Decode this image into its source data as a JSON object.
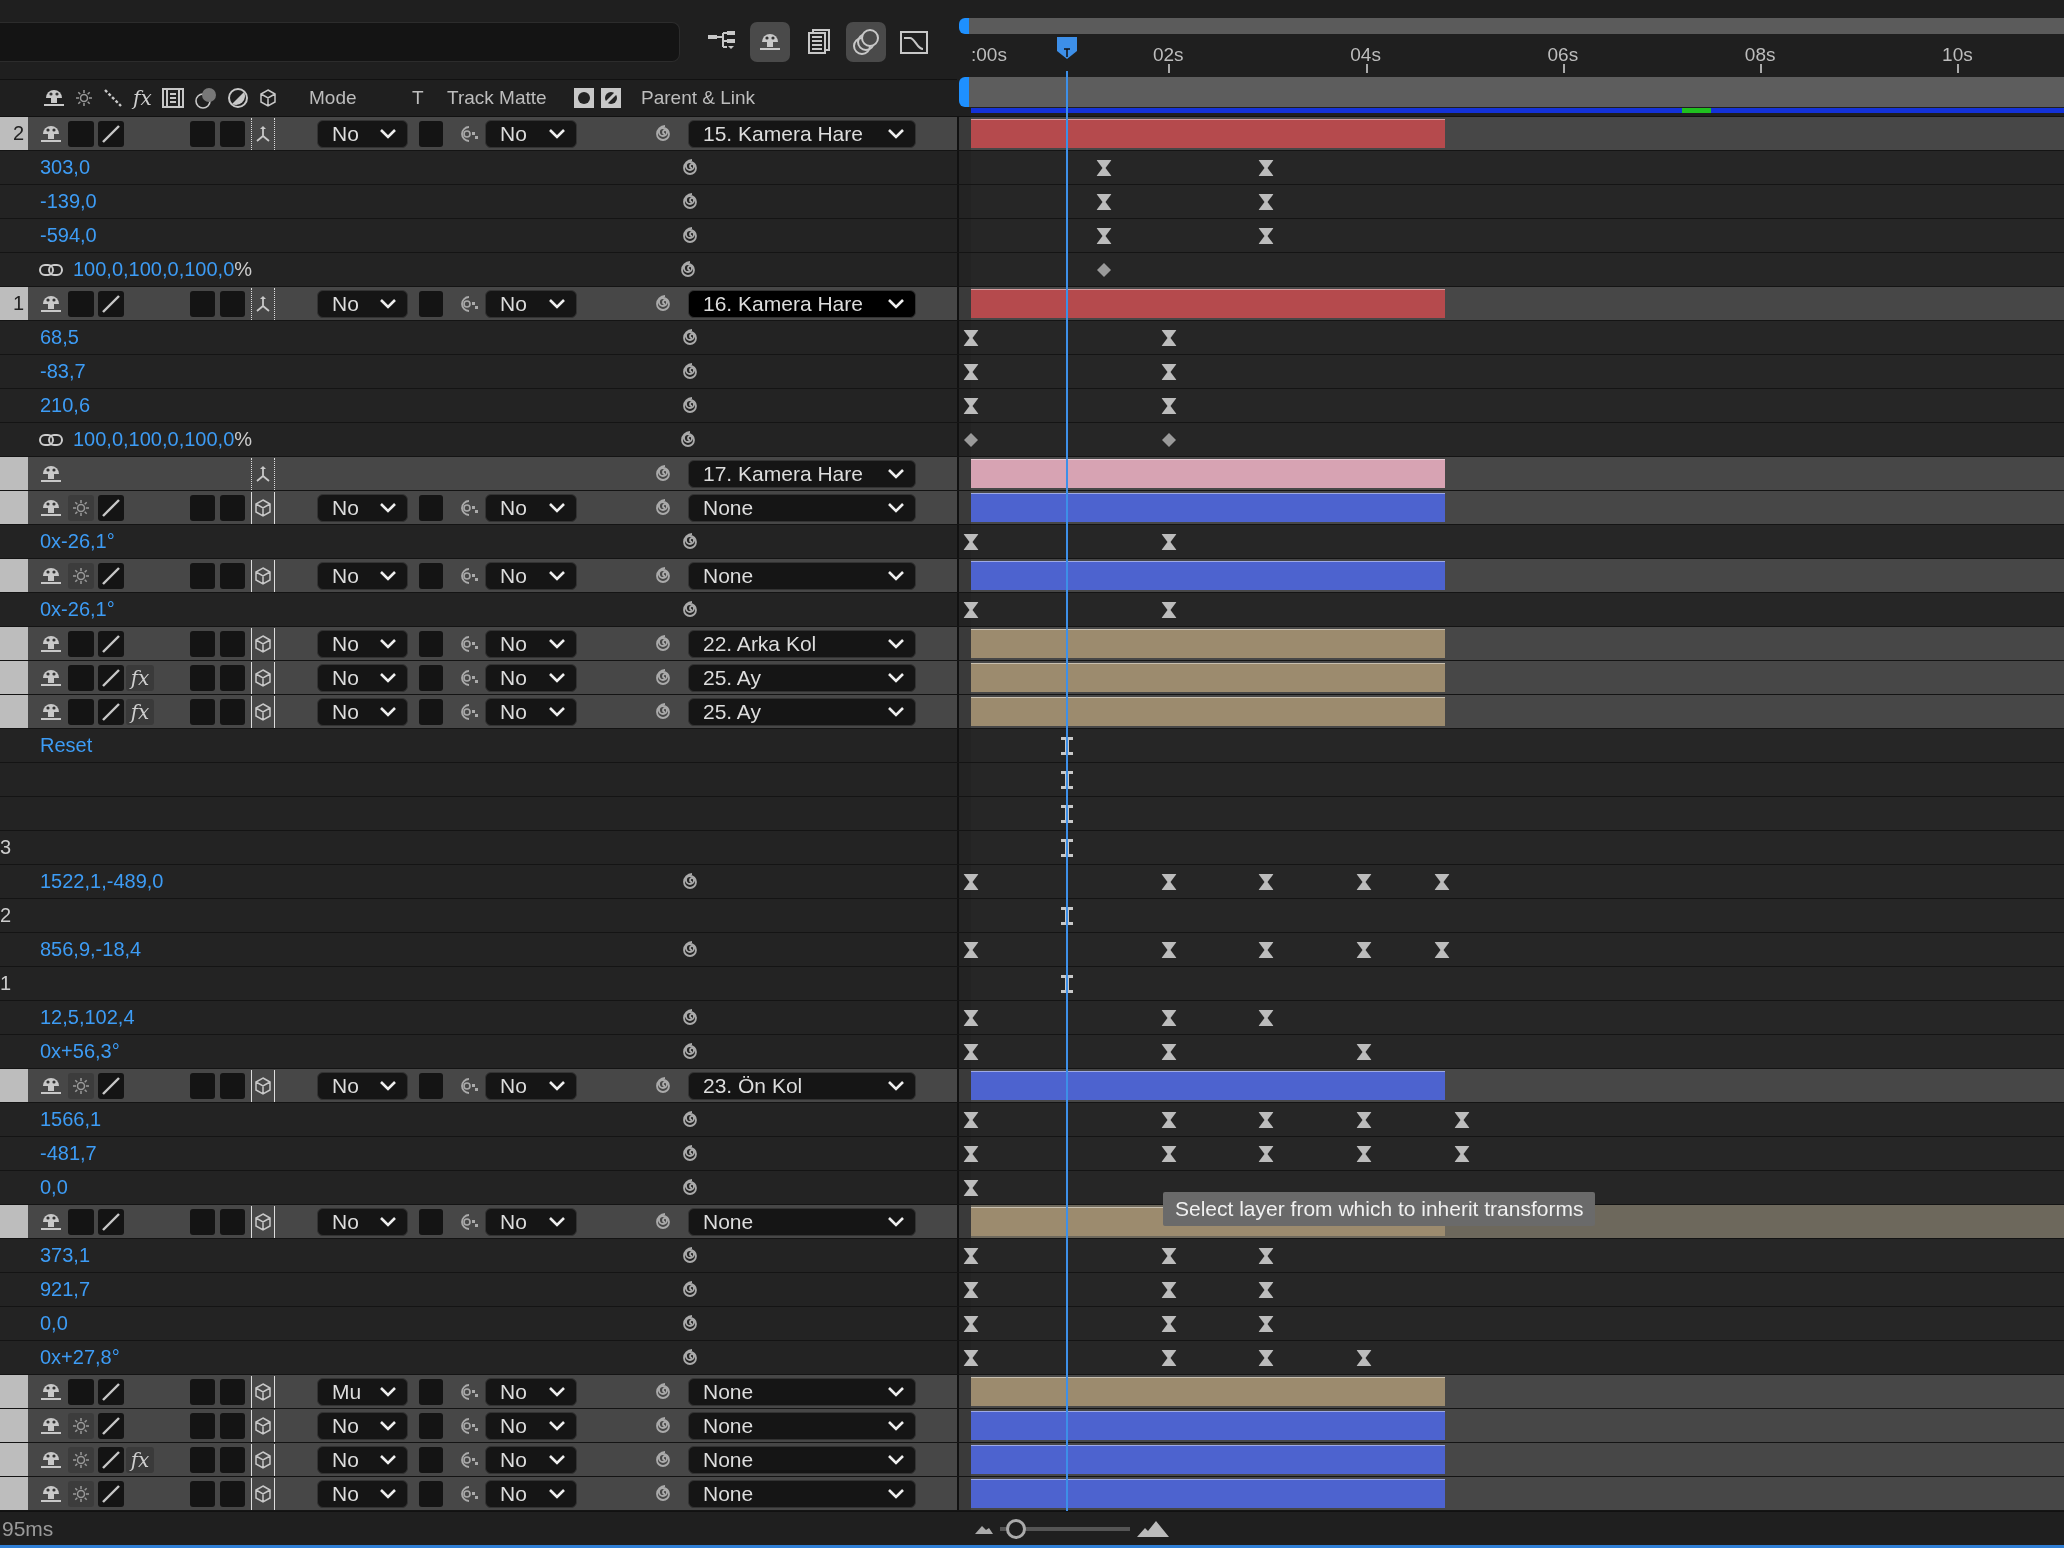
{
  "toolbar": {
    "buttons": [
      {
        "kind": "hierarchy",
        "selected": false
      },
      {
        "kind": "shy",
        "selected": true
      },
      {
        "kind": "frames",
        "selected": false
      },
      {
        "kind": "motion-blur",
        "selected": true
      },
      {
        "kind": "graph",
        "selected": false
      }
    ]
  },
  "header": {
    "fx": "fx",
    "mode": "Mode",
    "t": "T",
    "track_matte": "Track Matte",
    "parent": "Parent & Link"
  },
  "ruler": [
    ":00s",
    "02s",
    "04s",
    "06s",
    "08s",
    "10s"
  ],
  "playhead": {
    "level": 0.088
  },
  "rows": [
    {
      "kind": "layer",
      "label": "2",
      "camera": true,
      "collapse": false,
      "quality": true,
      "mode": "No",
      "track": "No",
      "parent": "15. Kamera Hare",
      "parent_focused": false,
      "selected": false,
      "bar": {
        "color": "#b54a4d",
        "level": 0.434
      }
    },
    {
      "kind": "property",
      "value": "303,0",
      "spiral": true,
      "keys": [
        {
          "kind": "ease",
          "level": 0.122
        },
        {
          "kind": "ease",
          "level": 0.27
        }
      ]
    },
    {
      "kind": "property",
      "value": "-139,0",
      "spiral": true,
      "keys": [
        {
          "kind": "ease",
          "level": 0.122
        },
        {
          "kind": "ease",
          "level": 0.27
        }
      ]
    },
    {
      "kind": "property",
      "value": "-594,0",
      "spiral": true,
      "keys": [
        {
          "kind": "ease",
          "level": 0.122
        },
        {
          "kind": "ease",
          "level": 0.27
        }
      ]
    },
    {
      "kind": "property",
      "linked": true,
      "value": "100,0,100,0,100,0",
      "unit": "%",
      "spiral": true,
      "keys": [
        {
          "kind": "diamond",
          "level": 0.122
        }
      ]
    },
    {
      "kind": "layer",
      "label": "1",
      "camera": true,
      "collapse": false,
      "quality": true,
      "mode": "No",
      "track": "No",
      "parent": "16. Kamera Hare",
      "parent_focused": true,
      "selected": false,
      "bar": {
        "color": "#b54a4d",
        "level": 0.434
      }
    },
    {
      "kind": "property",
      "value": "68,5",
      "spiral": true,
      "keys": [
        {
          "kind": "ease",
          "level": 0
        },
        {
          "kind": "ease",
          "level": 0.181
        }
      ]
    },
    {
      "kind": "property",
      "value": "-83,7",
      "spiral": true,
      "keys": [
        {
          "kind": "ease",
          "level": 0
        },
        {
          "kind": "ease",
          "level": 0.181
        }
      ]
    },
    {
      "kind": "property",
      "value": "210,6",
      "spiral": true,
      "keys": [
        {
          "kind": "ease",
          "level": 0
        },
        {
          "kind": "ease",
          "level": 0.181
        }
      ]
    },
    {
      "kind": "property",
      "linked": true,
      "value": "100,0,100,0,100,0",
      "unit": "%",
      "spiral": true,
      "keys": [
        {
          "kind": "diamond",
          "level": 0
        },
        {
          "kind": "diamond",
          "level": 0.181
        }
      ]
    },
    {
      "kind": "layer",
      "camera": true,
      "parent": "17. Kamera Hare",
      "parent_focused": false,
      "selected": false,
      "bar": {
        "color": "#d7a3b3",
        "level": 0.434
      }
    },
    {
      "kind": "layer",
      "camera": false,
      "collapse": true,
      "quality": true,
      "mode": "No",
      "track": "No",
      "parent": "None",
      "parent_focused": false,
      "selected": false,
      "bar": {
        "color": "#4d63cf",
        "level": 0.434
      }
    },
    {
      "kind": "property",
      "value": "0x-26,1°",
      "spiral": true,
      "keys": [
        {
          "kind": "ease",
          "level": 0
        },
        {
          "kind": "ease",
          "level": 0.181
        }
      ]
    },
    {
      "kind": "layer",
      "camera": false,
      "collapse": true,
      "quality": true,
      "mode": "No",
      "track": "No",
      "parent": "None",
      "parent_focused": false,
      "selected": false,
      "bar": {
        "color": "#4d63cf",
        "level": 0.434
      }
    },
    {
      "kind": "property",
      "value": "0x-26,1°",
      "spiral": true,
      "keys": [
        {
          "kind": "ease",
          "level": 0
        },
        {
          "kind": "ease",
          "level": 0.181
        }
      ]
    },
    {
      "kind": "layer",
      "camera": false,
      "collapse": false,
      "quality": true,
      "mode": "No",
      "track": "No",
      "parent": "22. Arka Kol",
      "parent_focused": false,
      "selected": false,
      "bar": {
        "color": "#9c8b6e",
        "level": 0.434
      }
    },
    {
      "kind": "layer",
      "camera": false,
      "collapse": false,
      "quality": true,
      "fx": "fx",
      "effects_on": true,
      "mode": "No",
      "track": "No",
      "parent": "25. Ay",
      "parent_focused": false,
      "selected": false,
      "bar": {
        "color": "#9c8b6e",
        "level": 0.434
      }
    },
    {
      "kind": "layer",
      "camera": false,
      "collapse": false,
      "quality": true,
      "fx": "fx",
      "effects_on": true,
      "mode": "No",
      "track": "No",
      "parent": "25. Ay",
      "parent_focused": false,
      "selected": false,
      "bar": {
        "color": "#9c8b6e",
        "level": 0.434
      }
    },
    {
      "kind": "property",
      "value": "Reset",
      "keys": [
        {
          "kind": "hold",
          "level": 0.088
        }
      ]
    },
    {
      "kind": "property",
      "keys": [
        {
          "kind": "hold",
          "level": 0.088
        }
      ]
    },
    {
      "kind": "property",
      "keys": [
        {
          "kind": "hold",
          "level": 0.088
        }
      ]
    },
    {
      "kind": "property",
      "index": "3",
      "keys": [
        {
          "kind": "hold",
          "level": 0.088
        }
      ]
    },
    {
      "kind": "property",
      "value": "1522,1,-489,0",
      "spiral": true,
      "keys": [
        {
          "kind": "ease",
          "level": 0
        },
        {
          "kind": "ease",
          "level": 0.181
        },
        {
          "kind": "ease",
          "level": 0.27
        },
        {
          "kind": "ease",
          "level": 0.36
        },
        {
          "kind": "ease",
          "level": 0.431
        }
      ]
    },
    {
      "kind": "property",
      "index": "2",
      "keys": [
        {
          "kind": "hold",
          "level": 0.088
        }
      ]
    },
    {
      "kind": "property",
      "value": "856,9,-18,4",
      "spiral": true,
      "keys": [
        {
          "kind": "ease",
          "level": 0
        },
        {
          "kind": "ease",
          "level": 0.181
        },
        {
          "kind": "ease",
          "level": 0.27
        },
        {
          "kind": "ease",
          "level": 0.36
        },
        {
          "kind": "ease",
          "level": 0.431
        }
      ]
    },
    {
      "kind": "property",
      "index": "1",
      "keys": [
        {
          "kind": "hold",
          "level": 0.088
        }
      ]
    },
    {
      "kind": "property",
      "value": "12,5,102,4",
      "spiral": true,
      "keys": [
        {
          "kind": "ease",
          "level": 0
        },
        {
          "kind": "ease",
          "level": 0.181
        },
        {
          "kind": "ease",
          "level": 0.27
        }
      ]
    },
    {
      "kind": "property",
      "value": "0x+56,3°",
      "spiral": true,
      "keys": [
        {
          "kind": "ease",
          "level": 0
        },
        {
          "kind": "ease",
          "level": 0.181
        },
        {
          "kind": "ease",
          "level": 0.36
        }
      ]
    },
    {
      "kind": "layer",
      "camera": false,
      "collapse": true,
      "quality": true,
      "mode": "No",
      "track": "No",
      "parent": "23. Ön Kol",
      "parent_focused": false,
      "selected": false,
      "bar": {
        "color": "#4d63cf",
        "level": 0.434
      }
    },
    {
      "kind": "property",
      "value": "1566,1",
      "spiral": true,
      "keys": [
        {
          "kind": "ease",
          "level": 0
        },
        {
          "kind": "ease",
          "level": 0.181
        },
        {
          "kind": "ease",
          "level": 0.27
        },
        {
          "kind": "ease",
          "level": 0.36
        },
        {
          "kind": "ease",
          "level": 0.449
        }
      ]
    },
    {
      "kind": "property",
      "value": "-481,7",
      "spiral": true,
      "keys": [
        {
          "kind": "ease",
          "level": 0
        },
        {
          "kind": "ease",
          "level": 0.181
        },
        {
          "kind": "ease",
          "level": 0.27
        },
        {
          "kind": "ease",
          "level": 0.36
        },
        {
          "kind": "ease",
          "level": 0.449
        }
      ]
    },
    {
      "kind": "property",
      "value": "0,0",
      "spiral": true,
      "keys": [
        {
          "kind": "ease",
          "level": 0
        }
      ]
    },
    {
      "kind": "layer",
      "camera": false,
      "collapse": false,
      "quality": true,
      "mode": "No",
      "track": "No",
      "parent": "None",
      "parent_focused": false,
      "selected": true,
      "bar": {
        "color": "#9c8b6e",
        "level": 0.434
      }
    },
    {
      "kind": "property",
      "value": "373,1",
      "spiral": true,
      "keys": [
        {
          "kind": "ease",
          "level": 0
        },
        {
          "kind": "ease",
          "level": 0.181
        },
        {
          "kind": "ease",
          "level": 0.27
        }
      ]
    },
    {
      "kind": "property",
      "value": "921,7",
      "spiral": true,
      "keys": [
        {
          "kind": "ease",
          "level": 0
        },
        {
          "kind": "ease",
          "level": 0.181
        },
        {
          "kind": "ease",
          "level": 0.27
        }
      ]
    },
    {
      "kind": "property",
      "value": "0,0",
      "spiral": true,
      "keys": [
        {
          "kind": "ease",
          "level": 0
        },
        {
          "kind": "ease",
          "level": 0.181
        },
        {
          "kind": "ease",
          "level": 0.27
        }
      ]
    },
    {
      "kind": "property",
      "value": "0x+27,8°",
      "spiral": true,
      "keys": [
        {
          "kind": "ease",
          "level": 0
        },
        {
          "kind": "ease",
          "level": 0.181
        },
        {
          "kind": "ease",
          "level": 0.27
        },
        {
          "kind": "ease",
          "level": 0.36
        }
      ]
    },
    {
      "kind": "layer",
      "camera": false,
      "collapse": false,
      "quality": true,
      "mode": "Mu",
      "track": "No",
      "parent": "None",
      "parent_focused": false,
      "selected": false,
      "bar": {
        "color": "#9c8b6e",
        "level": 0.434
      }
    },
    {
      "kind": "layer",
      "camera": false,
      "collapse": true,
      "quality": true,
      "mode": "No",
      "track": "No",
      "parent": "None",
      "parent_focused": false,
      "selected": false,
      "bar": {
        "color": "#4d63cf",
        "level": 0.434
      }
    },
    {
      "kind": "layer",
      "camera": false,
      "collapse": true,
      "quality": true,
      "fx": "fx",
      "effects_on": true,
      "mode": "No",
      "track": "No",
      "parent": "None",
      "parent_focused": false,
      "selected": false,
      "bar": {
        "color": "#4d63cf",
        "level": 0.434
      }
    },
    {
      "kind": "layer",
      "camera": false,
      "collapse": true,
      "quality": true,
      "mode": "No",
      "track": "No",
      "parent": "None",
      "parent_focused": false,
      "selected": false,
      "bar": {
        "color": "#4d63cf",
        "level": 0.434
      }
    }
  ],
  "tooltip": "Select layer from which to inherit transforms",
  "status": {
    "time": "95ms",
    "zoom": {
      "level": 0.05
    }
  }
}
